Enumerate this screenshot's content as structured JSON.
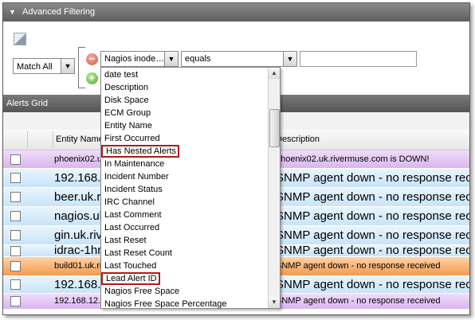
{
  "panel": {
    "title": "Advanced Filtering"
  },
  "filter": {
    "match_mode": "Match All",
    "field_selected": "Nagios inode…",
    "operator_selected": "equals",
    "value": ""
  },
  "grid": {
    "title": "Alerts Grid",
    "columns": [
      "Entity Name",
      "Description"
    ],
    "rows": [
      {
        "entity": "phoenix02.u",
        "description": "phoenix02.uk.rivermuse.com is DOWN!",
        "color": "purple",
        "size": "small"
      },
      {
        "entity": "192.168.",
        "description": "SNMP agent down - no response rece",
        "color": "blue",
        "size": "big"
      },
      {
        "entity": "beer.uk.r",
        "description": "SNMP agent down - no response rece",
        "color": "blue",
        "size": "big"
      },
      {
        "entity": "nagios.ul",
        "description": "SNMP agent down - no response rece",
        "color": "blue",
        "size": "big"
      },
      {
        "entity": "gin.uk.riv",
        "description": "SNMP agent down - no response rece",
        "color": "blue",
        "size": "big"
      },
      {
        "entity": "idrac-1hr",
        "description": "SNMP agent down - no response rece",
        "color": "blue",
        "size": "big"
      },
      {
        "entity": "build01.uk.ri",
        "description": "SNMP agent down - no response received",
        "color": "orange",
        "size": "small"
      },
      {
        "entity": "192.168.",
        "description": "SNMP agent down - no response rece",
        "color": "blue",
        "size": "big"
      },
      {
        "entity": "192.168.12.",
        "description": "SNMP agent down - no response received",
        "color": "purple",
        "size": "small"
      }
    ]
  },
  "dropdown": {
    "items": [
      "date test",
      "Description",
      "Disk Space",
      "ECM Group",
      "Entity Name",
      "First Occurred",
      "Has Nested Alerts",
      "In Maintenance",
      "Incident Number",
      "Incident Status",
      "IRC Channel",
      "Last Comment",
      "Last Occurred",
      "Last Reset",
      "Last Reset Count",
      "Last Touched",
      "Lead Alert ID",
      "Nagios Free Space",
      "Nagios Free Space Percentage"
    ],
    "highlighted": [
      "Has Nested Alerts",
      "Lead Alert ID"
    ]
  }
}
